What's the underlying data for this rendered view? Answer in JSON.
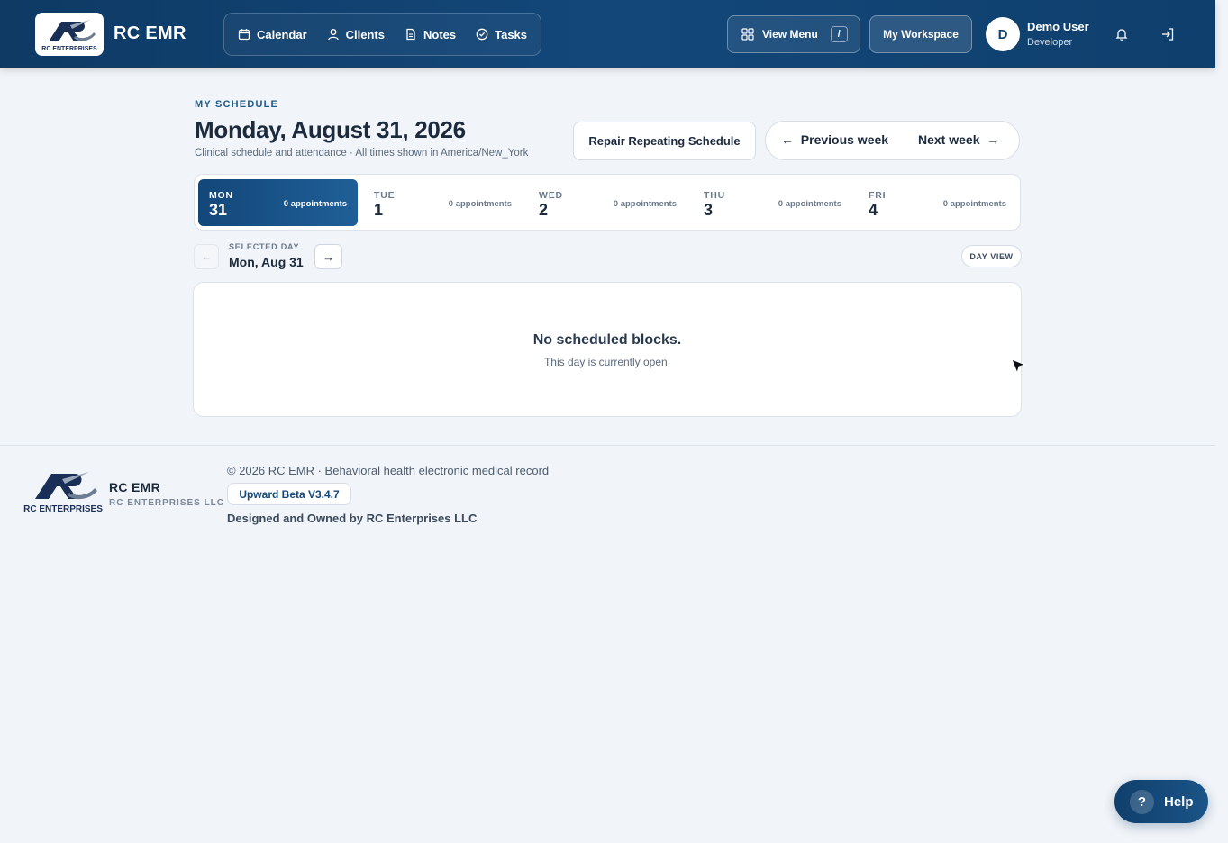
{
  "header": {
    "brand_name": "RC EMR",
    "logo_text": "RC ENTERPRISES",
    "nav": [
      {
        "label": "Calendar",
        "icon": "calendar-icon"
      },
      {
        "label": "Clients",
        "icon": "user-icon"
      },
      {
        "label": "Notes",
        "icon": "document-icon"
      },
      {
        "label": "Tasks",
        "icon": "check-circle-icon"
      }
    ],
    "view_menu_label": "View Menu",
    "view_menu_shortcut": "/",
    "workspace_label": "My Workspace",
    "user": {
      "initial": "D",
      "name": "Demo User",
      "role": "Developer"
    }
  },
  "schedule": {
    "eyebrow": "MY SCHEDULE",
    "title": "Monday, August 31, 2026",
    "subtitle": "Clinical schedule and attendance · All times shown in America/New_York",
    "repair_label": "Repair Repeating Schedule",
    "prev_week_label": "Previous week",
    "next_week_label": "Next week",
    "prev_arrow": "←",
    "next_arrow": "→",
    "days": [
      {
        "dow": "MON",
        "num": "31",
        "count": "0 appointments",
        "active": true
      },
      {
        "dow": "TUE",
        "num": "1",
        "count": "0 appointments",
        "active": false
      },
      {
        "dow": "WED",
        "num": "2",
        "count": "0 appointments",
        "active": false
      },
      {
        "dow": "THU",
        "num": "3",
        "count": "0 appointments",
        "active": false
      },
      {
        "dow": "FRI",
        "num": "4",
        "count": "0 appointments",
        "active": false
      }
    ],
    "selected_day_label": "SELECTED DAY",
    "selected_day": "Mon, Aug 31",
    "day_prev": "←",
    "day_next": "→",
    "day_view_label": "DAY VIEW",
    "empty_title": "No scheduled blocks.",
    "empty_sub": "This day is currently open."
  },
  "footer": {
    "name": "RC EMR",
    "company": "RC ENTERPRISES LLC",
    "copyright": "© 2026 RC EMR · Behavioral health electronic medical record",
    "version": "Upward Beta V3.4.7",
    "designed": "Designed and Owned by RC Enterprises LLC"
  },
  "help": {
    "icon_text": "?",
    "label": "Help"
  },
  "colors": {
    "header_bg": "#13477a",
    "accent": "#1d5a8c",
    "page_bg": "#f1f4f8"
  }
}
